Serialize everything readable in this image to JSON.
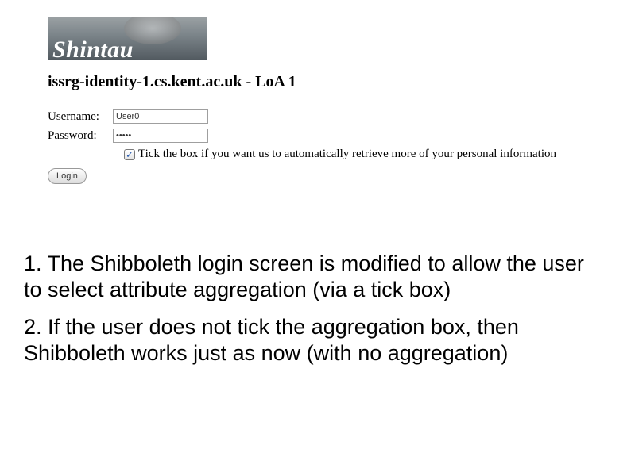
{
  "logo": {
    "text": "Shintau"
  },
  "heading": "issrg-identity-1.cs.kent.ac.uk - LoA 1",
  "form": {
    "username_label": "Username:",
    "username_value": "User0",
    "password_label": "Password:",
    "password_value": "•••••",
    "checkbox_checked": "✓",
    "checkbox_label": "Tick the box if you want us to automatically retrieve more of your personal information",
    "login_label": "Login"
  },
  "paragraphs": {
    "p1": "1. The Shibboleth login screen is modified to allow the user to select attribute aggregation (via a tick box)",
    "p2": "2. If the user does not tick the aggregation box, then Shibboleth works just as now (with no aggregation)"
  }
}
